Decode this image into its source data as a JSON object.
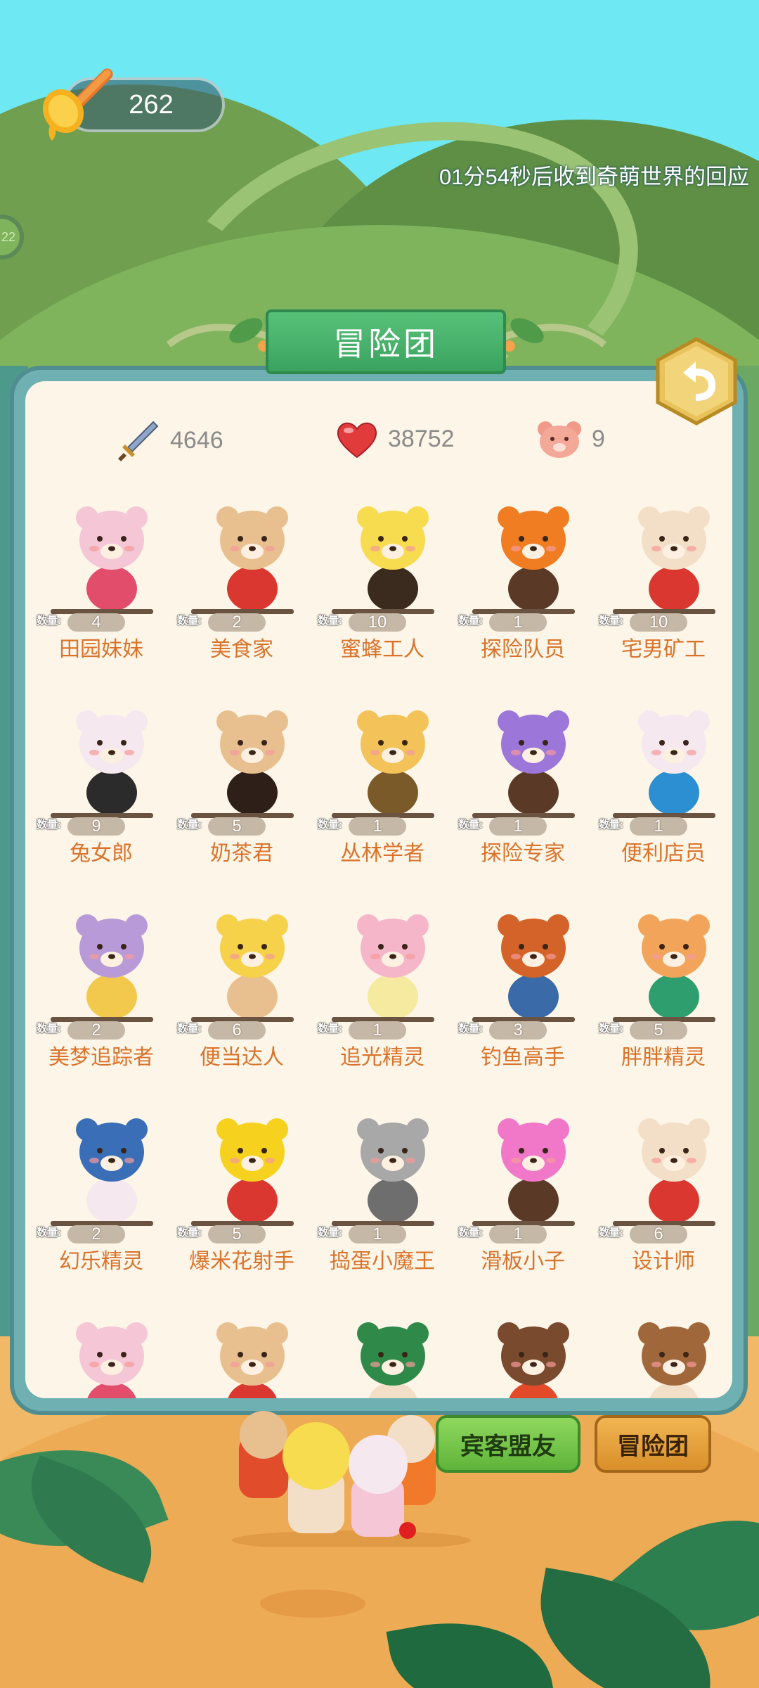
{
  "honey": {
    "count": "262"
  },
  "timer": {
    "text": "01分54秒后收到奇萌世界的回应"
  },
  "side_badge": {
    "text": "22"
  },
  "panel": {
    "title": "冒险团"
  },
  "stats": {
    "attack": "4646",
    "health": "38752",
    "members": "9"
  },
  "qty_prefix": "数量:",
  "characters": [
    {
      "name": "田园妹妹",
      "qty": "4",
      "color": "#f4c6d6",
      "accent": "#e14d6a"
    },
    {
      "name": "美食家",
      "qty": "2",
      "color": "#e8c08f",
      "accent": "#d9372f"
    },
    {
      "name": "蜜蜂工人",
      "qty": "10",
      "color": "#f6dc4e",
      "accent": "#3b2a1e"
    },
    {
      "name": "探险队员",
      "qty": "1",
      "color": "#f17d23",
      "accent": "#5a3a26"
    },
    {
      "name": "宅男矿工",
      "qty": "10",
      "color": "#f3dfc7",
      "accent": "#d9372f"
    },
    {
      "name": "兔女郎",
      "qty": "9",
      "color": "#f6e8ef",
      "accent": "#2b2b2b"
    },
    {
      "name": "奶茶君",
      "qty": "5",
      "color": "#e8c08f",
      "accent": "#2e2018"
    },
    {
      "name": "丛林学者",
      "qty": "1",
      "color": "#f3c35a",
      "accent": "#7b5a2a"
    },
    {
      "name": "探险专家",
      "qty": "1",
      "color": "#9c76d9",
      "accent": "#5a3a26"
    },
    {
      "name": "便利店员",
      "qty": "1",
      "color": "#f6e8ef",
      "accent": "#2b8fd1"
    },
    {
      "name": "美梦追踪者",
      "qty": "2",
      "color": "#b89ad8",
      "accent": "#f2c94c"
    },
    {
      "name": "便当达人",
      "qty": "6",
      "color": "#f6d24a",
      "accent": "#e8c08f"
    },
    {
      "name": "追光精灵",
      "qty": "1",
      "color": "#f4b6c8",
      "accent": "#f6e9a0"
    },
    {
      "name": "钓鱼高手",
      "qty": "3",
      "color": "#d4632a",
      "accent": "#3b6aa8"
    },
    {
      "name": "胖胖精灵",
      "qty": "5",
      "color": "#f2a55a",
      "accent": "#2f9e6e"
    },
    {
      "name": "幻乐精灵",
      "qty": "2",
      "color": "#3a6fb8",
      "accent": "#f6e8ef"
    },
    {
      "name": "爆米花射手",
      "qty": "5",
      "color": "#f6d21e",
      "accent": "#d9372f"
    },
    {
      "name": "捣蛋小魔王",
      "qty": "1",
      "color": "#a8a8a8",
      "accent": "#6e6e6e"
    },
    {
      "name": "滑板小子",
      "qty": "1",
      "color": "#f178c8",
      "accent": "#5a3a26"
    },
    {
      "name": "设计师",
      "qty": "6",
      "color": "#f3dfc7",
      "accent": "#d9372f"
    },
    {
      "name": "",
      "qty": "",
      "color": "#f4c6d6",
      "accent": "#e14d6a"
    },
    {
      "name": "",
      "qty": "",
      "color": "#e8c08f",
      "accent": "#d9372f"
    },
    {
      "name": "",
      "qty": "",
      "color": "#2f8a4a",
      "accent": "#f3dfc7"
    },
    {
      "name": "",
      "qty": "",
      "color": "#7a4a2e",
      "accent": "#e34a2a"
    },
    {
      "name": "",
      "qty": "",
      "color": "#a0673a",
      "accent": "#f3dfc7"
    }
  ],
  "buttons": {
    "guests": "宾客盟友",
    "team": "冒险团"
  },
  "icons": {
    "honey": "honey-dipper-icon",
    "attack": "sword-icon",
    "health": "heart-icon",
    "members": "bear-face-icon",
    "back": "back-arrow-icon"
  }
}
